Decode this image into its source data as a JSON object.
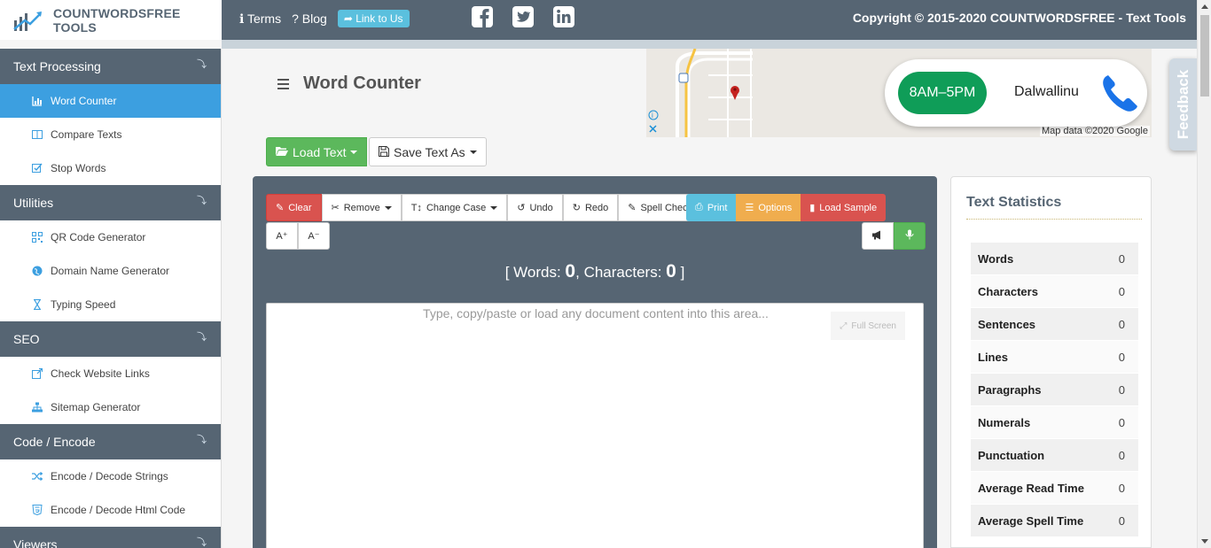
{
  "brand": {
    "name": "COUNTWORDSFREE TOOLS"
  },
  "topnav": {
    "terms": "Terms",
    "blog": "Blog",
    "link_to_us": "Link to Us"
  },
  "copyright": "Copyright © 2015-2020  COUNTWORDSFREE - Text Tools",
  "sidebar": {
    "sections": [
      {
        "title": "Text Processing",
        "items": [
          {
            "label": "Word Counter",
            "icon": "bar-chart-icon",
            "active": true
          },
          {
            "label": "Compare Texts",
            "icon": "columns-icon"
          },
          {
            "label": "Stop Words",
            "icon": "checkbox-icon"
          }
        ]
      },
      {
        "title": "Utilities",
        "items": [
          {
            "label": "QR Code Generator",
            "icon": "qrcode-icon"
          },
          {
            "label": "Domain Name Generator",
            "icon": "globe-icon"
          },
          {
            "label": "Typing Speed",
            "icon": "hourglass-icon"
          }
        ]
      },
      {
        "title": "SEO",
        "items": [
          {
            "label": "Check Website Links",
            "icon": "external-link-icon"
          },
          {
            "label": "Sitemap Generator",
            "icon": "sitemap-icon"
          }
        ]
      },
      {
        "title": "Code / Encode",
        "items": [
          {
            "label": "Encode / Decode Strings",
            "icon": "shuffle-icon"
          },
          {
            "label": "Encode / Decode Html Code",
            "icon": "html5-icon"
          }
        ]
      },
      {
        "title": "Viewers",
        "items": []
      }
    ]
  },
  "main": {
    "title": "Word Counter",
    "load_text": "Load Text",
    "save_text": "Save Text As"
  },
  "ad": {
    "hours": "8AM–5PM",
    "place": "Dalwallinu",
    "map_credit": "Map data ©2020 Google"
  },
  "feedback": "Feedback",
  "toolbar": {
    "clear": "Clear",
    "remove": "Remove",
    "change_case": "Change Case",
    "undo": "Undo",
    "redo": "Redo",
    "spell_check": "Spell Check",
    "print": "Print",
    "options": "Options",
    "load_sample": "Load Sample",
    "font_up": "A⁺",
    "font_down": "A⁻"
  },
  "counter": {
    "words_label": "Words:",
    "words": "0",
    "chars_label": "Characters:",
    "chars": "0"
  },
  "editor": {
    "placeholder": "Type, copy/paste or load any document content into this area...",
    "full_screen": "Full Screen"
  },
  "stats": {
    "title": "Text Statistics",
    "rows": [
      {
        "label": "Words",
        "value": "0"
      },
      {
        "label": "Characters",
        "value": "0"
      },
      {
        "label": "Sentences",
        "value": "0"
      },
      {
        "label": "Lines",
        "value": "0"
      },
      {
        "label": "Paragraphs",
        "value": "0"
      },
      {
        "label": "Numerals",
        "value": "0"
      },
      {
        "label": "Punctuation",
        "value": "0"
      },
      {
        "label": "Average Read Time",
        "value": "0"
      },
      {
        "label": "Average Spell Time",
        "value": "0"
      }
    ]
  },
  "colors": {
    "header": "#566573",
    "accent": "#3c9fe0",
    "green": "#5cb85c",
    "red": "#d9534f",
    "orange": "#f0ad4e",
    "info": "#5bc0de"
  }
}
